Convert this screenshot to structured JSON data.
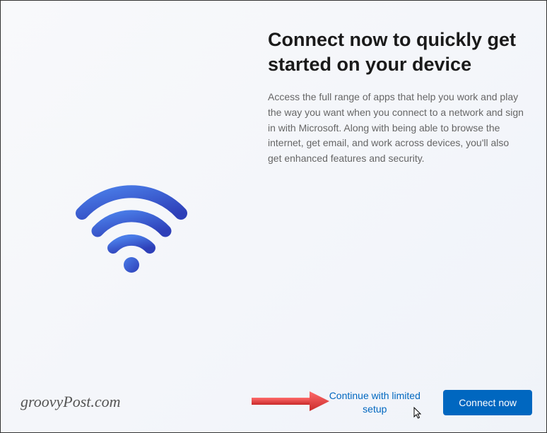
{
  "main": {
    "title": "Connect now to quickly get started on your device",
    "description": "Access the full range of apps that help you work and play the way you want when you connect to a network and sign in with Microsoft. Along with being able to browse the internet, get email, and work across devices, you'll also get enhanced features and security."
  },
  "footer": {
    "limited_label": "Continue with limited setup",
    "connect_label": "Connect now"
  },
  "watermark": "groovyPost.com"
}
